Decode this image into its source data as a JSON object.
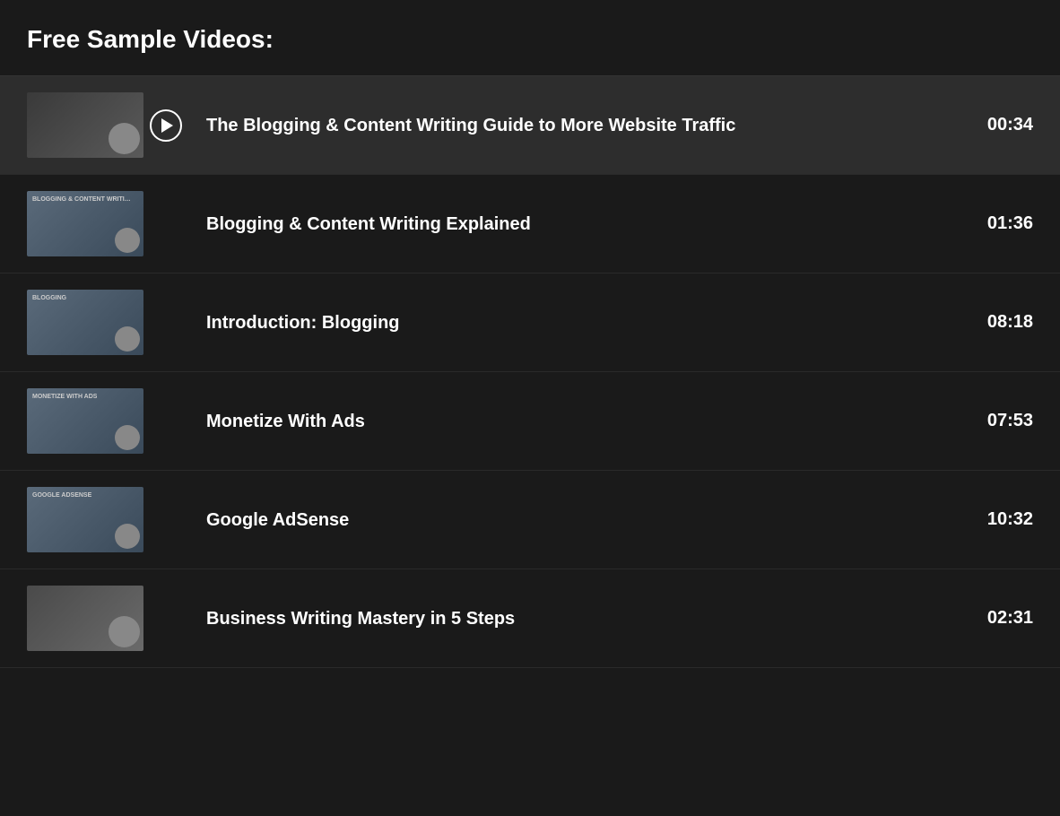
{
  "header": {
    "title": "Free Sample Videos:"
  },
  "videos": [
    {
      "id": 1,
      "title": "The Blogging & Content Writing Guide to More Website Traffic",
      "duration": "00:34",
      "active": true,
      "has_play_button": true,
      "thumb_type": "face",
      "thumb_label": ""
    },
    {
      "id": 2,
      "title": "Blogging & Content Writing Explained",
      "duration": "01:36",
      "active": false,
      "has_play_button": false,
      "thumb_type": "slides",
      "thumb_label": "BLOGGING & CONTENT WRITING EXPLAINED"
    },
    {
      "id": 3,
      "title": "Introduction: Blogging",
      "duration": "08:18",
      "active": false,
      "has_play_button": false,
      "thumb_type": "slides",
      "thumb_label": "BLOGGING"
    },
    {
      "id": 4,
      "title": "Monetize With Ads",
      "duration": "07:53",
      "active": false,
      "has_play_button": false,
      "thumb_type": "slides",
      "thumb_label": "MONETIZE WITH ADS"
    },
    {
      "id": 5,
      "title": "Google AdSense",
      "duration": "10:32",
      "active": false,
      "has_play_button": false,
      "thumb_type": "slides",
      "thumb_label": "GOOGLE ADSENSE"
    },
    {
      "id": 6,
      "title": "Business Writing Mastery in 5 Steps",
      "duration": "02:31",
      "active": false,
      "has_play_button": false,
      "thumb_type": "face",
      "thumb_label": ""
    }
  ]
}
